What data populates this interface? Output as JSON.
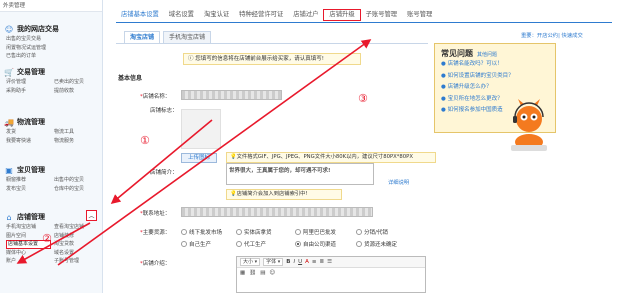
{
  "sidebar": {
    "top_item": "外卖管理",
    "groups": [
      {
        "title": "我的网店交易",
        "icon": "user-icon",
        "links": [
          "出售的宝贝交易",
          "闲置物况试运管理",
          "已售出的订单"
        ]
      },
      {
        "title": "交易管理",
        "icon": "cart-icon",
        "links": [
          "评价管理",
          "已卖出的宝贝",
          "采购助手",
          "提前收款"
        ]
      },
      {
        "title": "物流管理",
        "icon": "truck-icon",
        "links": [
          "发货",
          "物流工具",
          "我要寄快递",
          "物流服务"
        ]
      },
      {
        "title": "宝贝管理",
        "icon": "box-icon",
        "links": [
          "橱窗推荐",
          "出售中的宝贝",
          "发布宝贝",
          "仓库中的宝贝"
        ]
      },
      {
        "title": "店铺管理",
        "icon": "shop-icon",
        "links": [
          "手机淘宝店铺",
          "查看淘宝店铺",
          "图片空间",
          "店铺装修",
          "店铺基本设置",
          "淘宝贷款",
          "媒体中心",
          "域名设置",
          "账户",
          "子账号管理"
        ]
      }
    ],
    "active_link": "店铺基本设置",
    "collapse_icon": "chevron-up-icon"
  },
  "tabs": [
    "店铺基本设置",
    "域名设置",
    "淘宝认证",
    "特种经营许可证",
    "店铺过户",
    "店铺升级",
    "子账号管理",
    "账号管理"
  ],
  "active_tab": "店铺基本设置",
  "highlight_tab": "店铺升级",
  "top_help": "重要：开店公约| 快速成交",
  "subtabs": [
    "淘宝店铺",
    "手机淘宝店铺"
  ],
  "notice": "您填写的信息将在店铺前台展示给买家，请认真填写!",
  "form": {
    "section": "基本信息",
    "shop_name_label": "店铺名称：",
    "shop_label_label": "店铺标志：",
    "upload_button": "上传图标",
    "upload_tip": "文件格式GIF、JPG、JPEG、PNG文件大小80K以内，建议尺寸80PX*80PX",
    "intro_label": "店铺简介：",
    "intro_text": "世界很大，王真属于您的，却可遇不可求!",
    "intro_link": "详细说明",
    "intro_tip": "店铺简介会加入到店铺索引中!",
    "address_label": "联系地址：",
    "source_label": "主要货源：",
    "sources": [
      "线下批发市场",
      "实体店拿货",
      "阿里巴巴批发",
      "分销/代销",
      "自己生产",
      "代工生产",
      "自由公司渠道",
      "货源还未确定"
    ],
    "source_selected": "自由公司渠道",
    "desc_label": "店铺介绍：",
    "editor_size": "大小",
    "editor_font": "字体",
    "editor_bold": "B",
    "editor_italic": "I",
    "editor_underline": "U"
  },
  "popup": {
    "title": "常见问题",
    "more": "其他问题",
    "items": [
      "店铺名能改吗？可以！",
      "如何设置店铺的宝贝类目？",
      "店铺升级怎么办？",
      "宝贝所在地怎么更改？",
      "如何报名参加中国质造"
    ]
  },
  "annotations": [
    "①",
    "②",
    "③"
  ],
  "colors": {
    "accent": "#2e7bcf",
    "marker": "#e8192c"
  }
}
